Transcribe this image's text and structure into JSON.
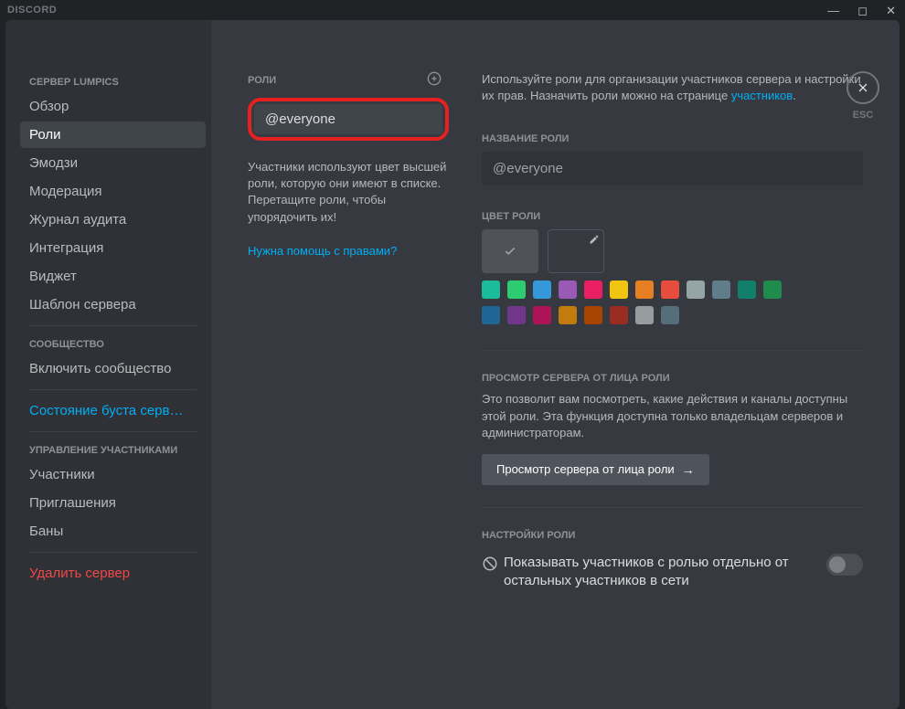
{
  "app_title": "DISCORD",
  "close_label": "ESC",
  "sidebar": {
    "server_label": "Сервер Lumpics",
    "items_a": [
      {
        "label": "Обзор"
      },
      {
        "label": "Роли",
        "active": true
      },
      {
        "label": "Эмодзи"
      },
      {
        "label": "Модерация"
      },
      {
        "label": "Журнал аудита"
      },
      {
        "label": "Интеграция"
      },
      {
        "label": "Виджет"
      },
      {
        "label": "Шаблон сервера"
      }
    ],
    "community_label": "Сообщество",
    "community_item": "Включить сообщество",
    "boost_item": "Состояние буста серв…",
    "manage_label": "Управление участниками",
    "items_b": [
      {
        "label": "Участники"
      },
      {
        "label": "Приглашения"
      },
      {
        "label": "Баны"
      }
    ],
    "delete_item": "Удалить сервер"
  },
  "roles": {
    "header": "Роли",
    "list": [
      {
        "name": "@everyone"
      }
    ],
    "help_text": "Участники используют цвет высшей роли, которую они имеют в списке. Перетащите роли, чтобы упорядочить их!",
    "help_link": "Нужна помощь с правами?"
  },
  "detail": {
    "intro_a": "Используйте роли для организации участников сервера и настройки их прав. Назначить роли можно на странице ",
    "intro_link": "участников",
    "intro_b": ".",
    "name_label": "Название роли",
    "name_value": "@everyone",
    "color_label": "Цвет роли",
    "colors": [
      "#1abc9c",
      "#2ecc71",
      "#3498db",
      "#9b59b6",
      "#e91e63",
      "#f1c40f",
      "#e67e22",
      "#e74c3c",
      "#95a5a6",
      "#607d8b",
      "#11806a",
      "#1f8b4c",
      "#206694",
      "#71368a",
      "#ad1457",
      "#c27c0e",
      "#a84300",
      "#992d22",
      "#979c9f",
      "#546e7a"
    ],
    "preview_label": "Просмотр сервера от лица роли",
    "preview_desc": "Это позволит вам посмотреть, какие действия и каналы доступны этой роли. Эта функция доступна только владельцам серверов и администраторам.",
    "preview_btn": "Просмотр сервера от лица роли",
    "settings_label": "Настройки роли",
    "setting1": "Показывать участников с ролью отдельно от остальных участников в сети"
  }
}
